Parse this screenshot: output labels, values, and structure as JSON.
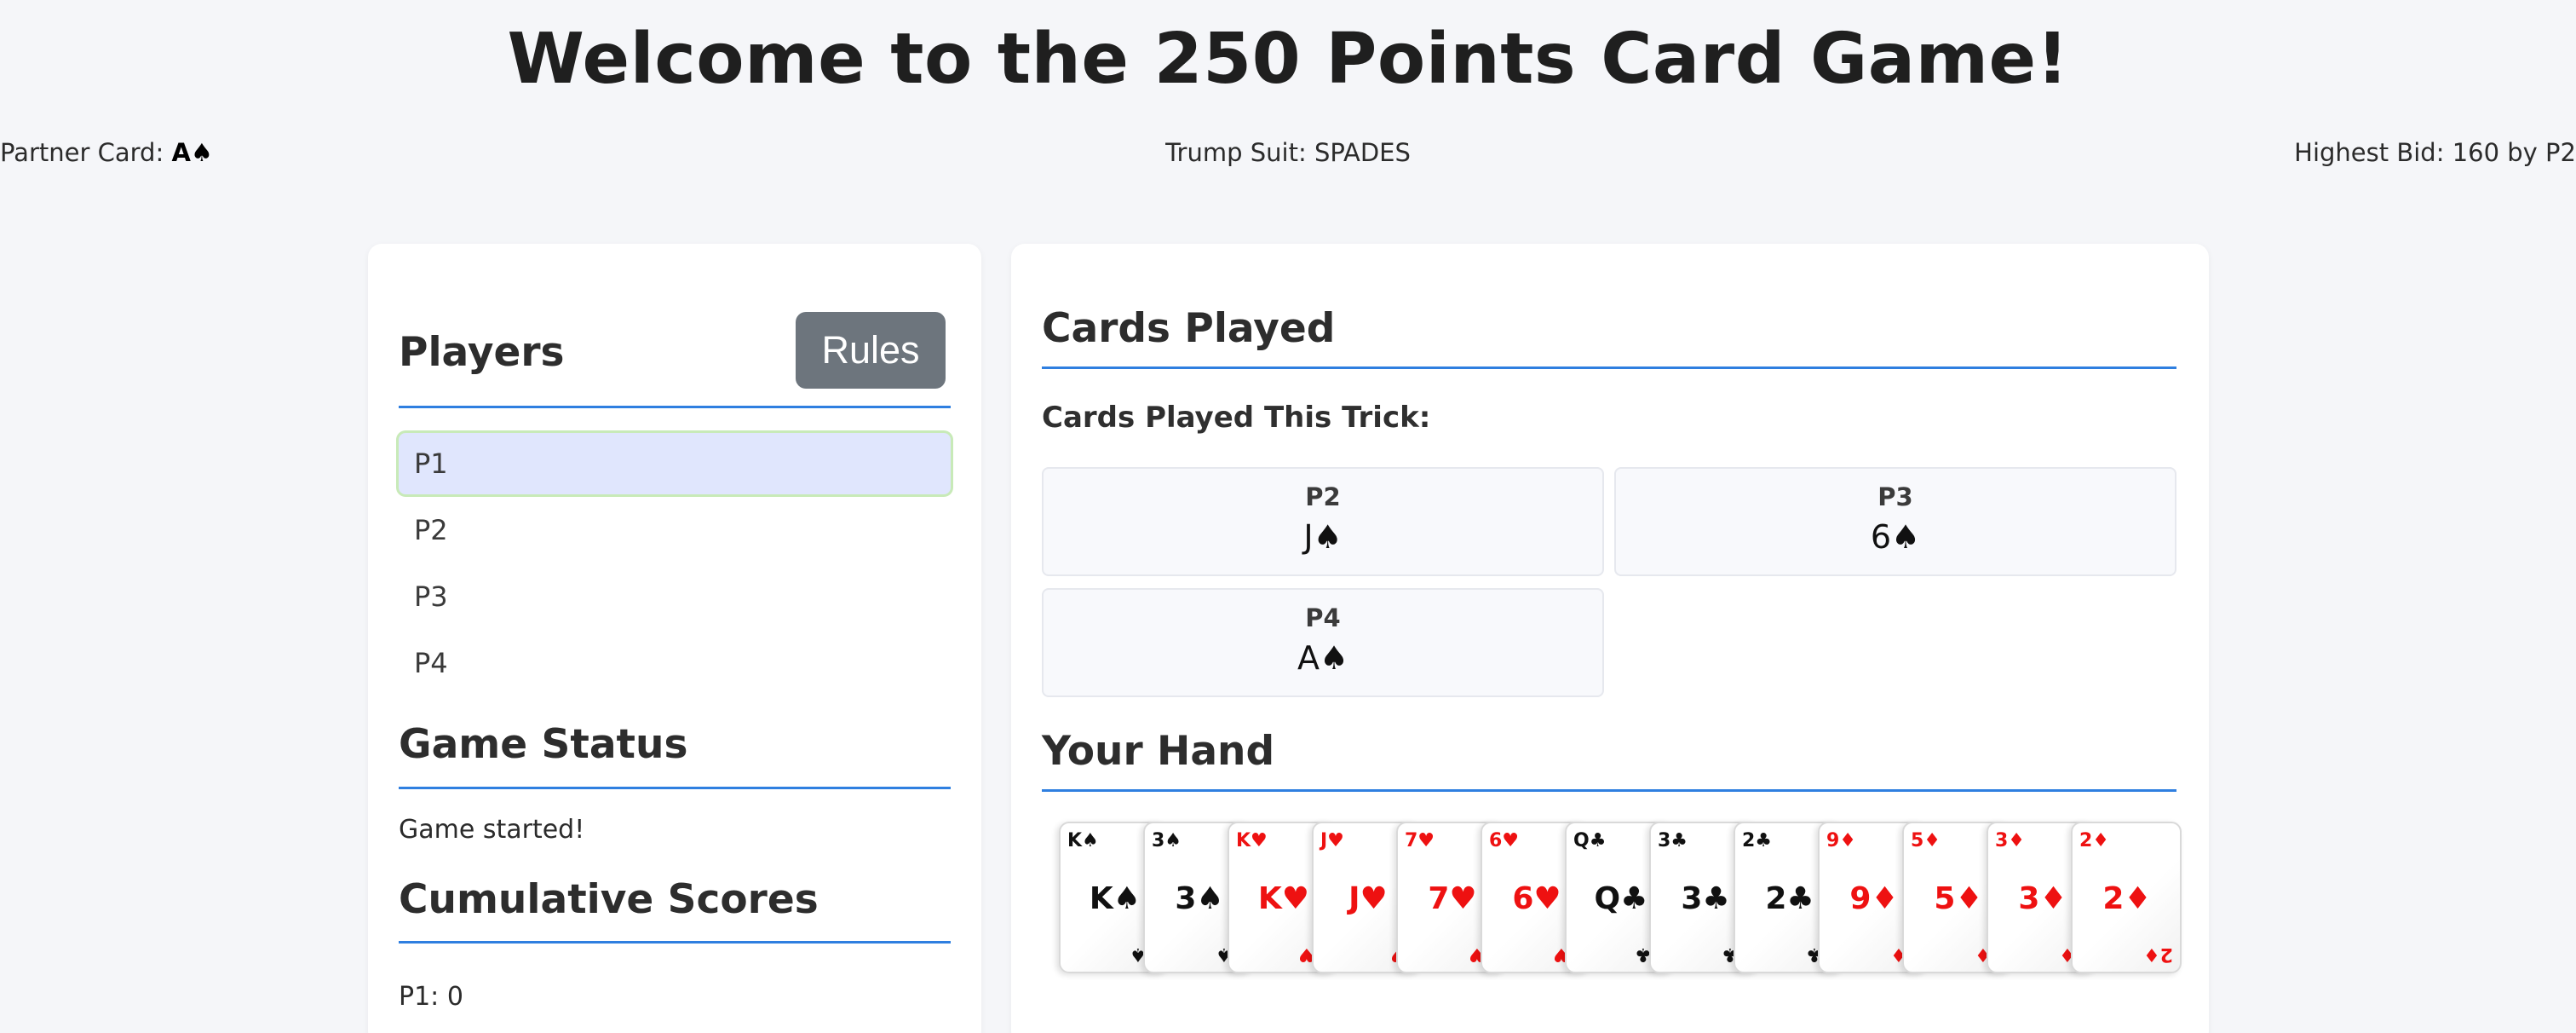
{
  "page": {
    "title": "Welcome to the 250 Points Card Game!"
  },
  "info": {
    "partner_label": "Partner Card: ",
    "partner_value": "A♠",
    "trump_label": "Trump Suit: SPADES",
    "bid_label": "Highest Bid: 160 by P2"
  },
  "players_panel": {
    "title": "Players",
    "rules_button": "Rules",
    "players": [
      "P1",
      "P2",
      "P3",
      "P4"
    ],
    "active_player": "P1"
  },
  "game_status": {
    "title": "Game Status",
    "text": "Game started!"
  },
  "scores": {
    "title": "Cumulative Scores",
    "items": [
      "P1: 0"
    ]
  },
  "cards_played": {
    "title": "Cards Played",
    "trick_label": "Cards Played This Trick:",
    "trick": [
      {
        "player": "P2",
        "card": "J♠"
      },
      {
        "player": "P3",
        "card": "6♠"
      },
      {
        "player": "P4",
        "card": "A♠"
      }
    ]
  },
  "hand": {
    "title": "Your Hand",
    "cards": [
      {
        "label": "K♠",
        "color": "black"
      },
      {
        "label": "3♠",
        "color": "black"
      },
      {
        "label": "K♥",
        "color": "red"
      },
      {
        "label": "J♥",
        "color": "red"
      },
      {
        "label": "7♥",
        "color": "red"
      },
      {
        "label": "6♥",
        "color": "red"
      },
      {
        "label": "Q♣",
        "color": "black"
      },
      {
        "label": "3♣",
        "color": "black"
      },
      {
        "label": "2♣",
        "color": "black"
      },
      {
        "label": "9♦",
        "color": "red"
      },
      {
        "label": "5♦",
        "color": "red"
      },
      {
        "label": "3♦",
        "color": "red"
      },
      {
        "label": "2♦",
        "color": "red"
      }
    ]
  },
  "colors": {
    "accent": "#2f7fe0",
    "rules_button": "#6d757d",
    "active_player_bg": "#e0e6fd",
    "red_suit": "#ee1111"
  }
}
